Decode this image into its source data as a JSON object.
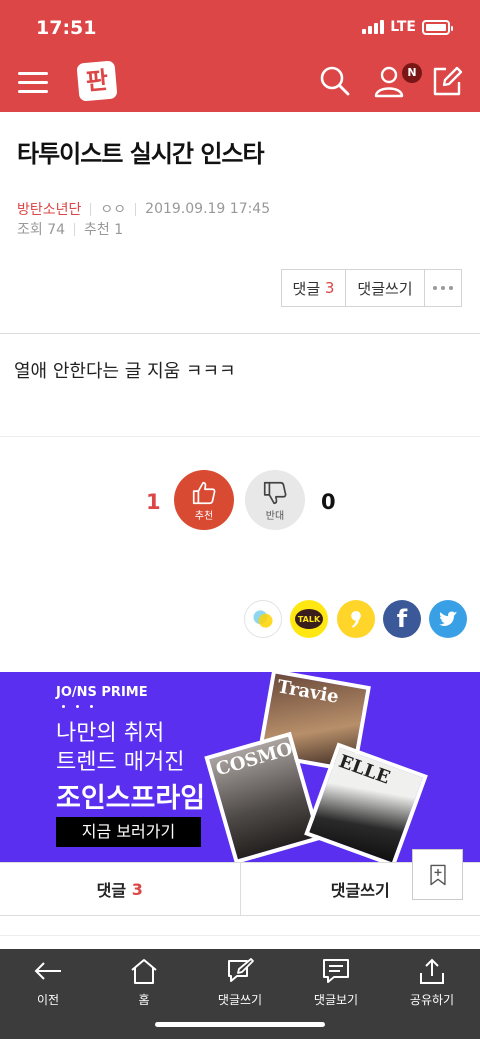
{
  "status_bar": {
    "time": "17:51",
    "network": "LTE"
  },
  "header": {
    "logo_text": "판",
    "notification_badge": "N"
  },
  "post": {
    "title": "타투이스트 실시간 인스타",
    "board": "방탄소년단",
    "author": "ㅇㅇ",
    "datetime": "2019.09.19 17:45",
    "views": "조회 74",
    "recommends": "추천 1",
    "body": "열애 안한다는 글 지움 ㅋㅋㅋ"
  },
  "actions": {
    "comment_label": "댓글",
    "comment_count": "3",
    "write_comment_label": "댓글쓰기"
  },
  "vote": {
    "up_count": "1",
    "up_label": "추천",
    "down_count": "0",
    "down_label": "반대"
  },
  "share": {
    "kakaotalk_text": "TALK",
    "facebook_text": "f"
  },
  "ad": {
    "brand": "JO/NS PRIME",
    "line1": "나만의 취저",
    "line2": "트렌드 매거진",
    "line3": "조인스프라임",
    "cta": "지금 보러가기",
    "magazine1_title": "Travie",
    "magazine2_title": "COSMO",
    "magazine3_title": "ELLE"
  },
  "comment_bar": {
    "comment_label": "댓글",
    "comment_count": "3",
    "write_label": "댓글쓰기"
  },
  "bottom_nav": [
    {
      "label": "이전",
      "icon": "arrow-left-icon"
    },
    {
      "label": "홈",
      "icon": "home-icon"
    },
    {
      "label": "댓글쓰기",
      "icon": "write-comment-icon"
    },
    {
      "label": "댓글보기",
      "icon": "view-comment-icon"
    },
    {
      "label": "공유하기",
      "icon": "share-icon"
    }
  ],
  "colors": {
    "brand_red": "#dc4646",
    "vote_up": "#d94a33",
    "ad_purple": "#5a2ff0",
    "bottom_bar": "#3c3c3c"
  }
}
